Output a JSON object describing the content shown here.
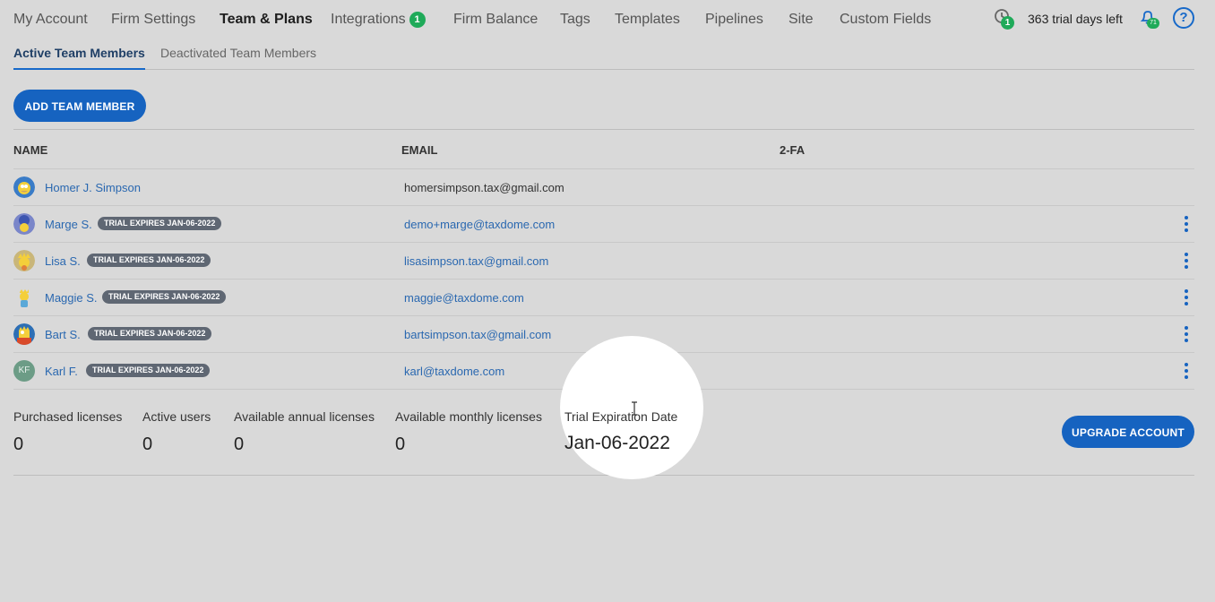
{
  "nav": {
    "items": [
      {
        "label": "My Account"
      },
      {
        "label": "Firm Settings"
      },
      {
        "label": "Team & Plans",
        "active": true
      },
      {
        "label": "Integrations",
        "badge": "1"
      },
      {
        "label": "Firm Balance"
      },
      {
        "label": "Tags"
      },
      {
        "label": "Templates"
      },
      {
        "label": "Pipelines"
      },
      {
        "label": "Site"
      },
      {
        "label": "Custom Fields"
      }
    ],
    "clock_badge": "1",
    "trial_days": "363 trial days left",
    "bell_badge": "71",
    "help_icon": "?"
  },
  "subtabs": {
    "active": "Active Team Members",
    "inactive": "Deactivated Team Members"
  },
  "add_button": "ADD TEAM MEMBER",
  "table": {
    "headers": {
      "name": "NAME",
      "email": "EMAIL",
      "twofa": "2-FA"
    },
    "rows": [
      {
        "name": "Homer J. Simpson",
        "badge": "",
        "email": "homersimpson.tax@gmail.com",
        "avatar": "homer-avatar"
      },
      {
        "name": "Marge S.",
        "badge": "TRIAL EXPIRES JAN-06-2022",
        "email": "demo+marge@taxdome.com",
        "avatar": "marge-avatar"
      },
      {
        "name": "Lisa S.",
        "badge": "TRIAL EXPIRES JAN-06-2022",
        "email": "lisasimpson.tax@gmail.com",
        "avatar": "lisa-avatar"
      },
      {
        "name": "Maggie S.",
        "badge": "TRIAL EXPIRES JAN-06-2022",
        "email": "maggie@taxdome.com",
        "avatar": "maggie-avatar"
      },
      {
        "name": "Bart S.",
        "badge": "TRIAL EXPIRES JAN-06-2022",
        "email": "bartsimpson.tax@gmail.com",
        "avatar": "bart-avatar"
      },
      {
        "name": "Karl F.",
        "badge": "TRIAL EXPIRES JAN-06-2022",
        "email": "karl@taxdome.com",
        "avatar": "initials-avatar",
        "initials": "KF"
      }
    ]
  },
  "stats": {
    "purchased": {
      "label": "Purchased licenses",
      "value": "0"
    },
    "active": {
      "label": "Active users",
      "value": "0"
    },
    "annual": {
      "label": "Available annual licenses",
      "value": "0"
    },
    "monthly": {
      "label": "Available monthly licenses",
      "value": "0"
    },
    "trial": {
      "label": "Trial Expiration Date",
      "value": "Jan-06-2022"
    }
  },
  "upgrade_button": "UPGRADE ACCOUNT",
  "colors": {
    "accent": "#1663c0",
    "badge_green": "#1faa59",
    "link": "#2a68b0",
    "trial_badge": "#5f6773"
  }
}
